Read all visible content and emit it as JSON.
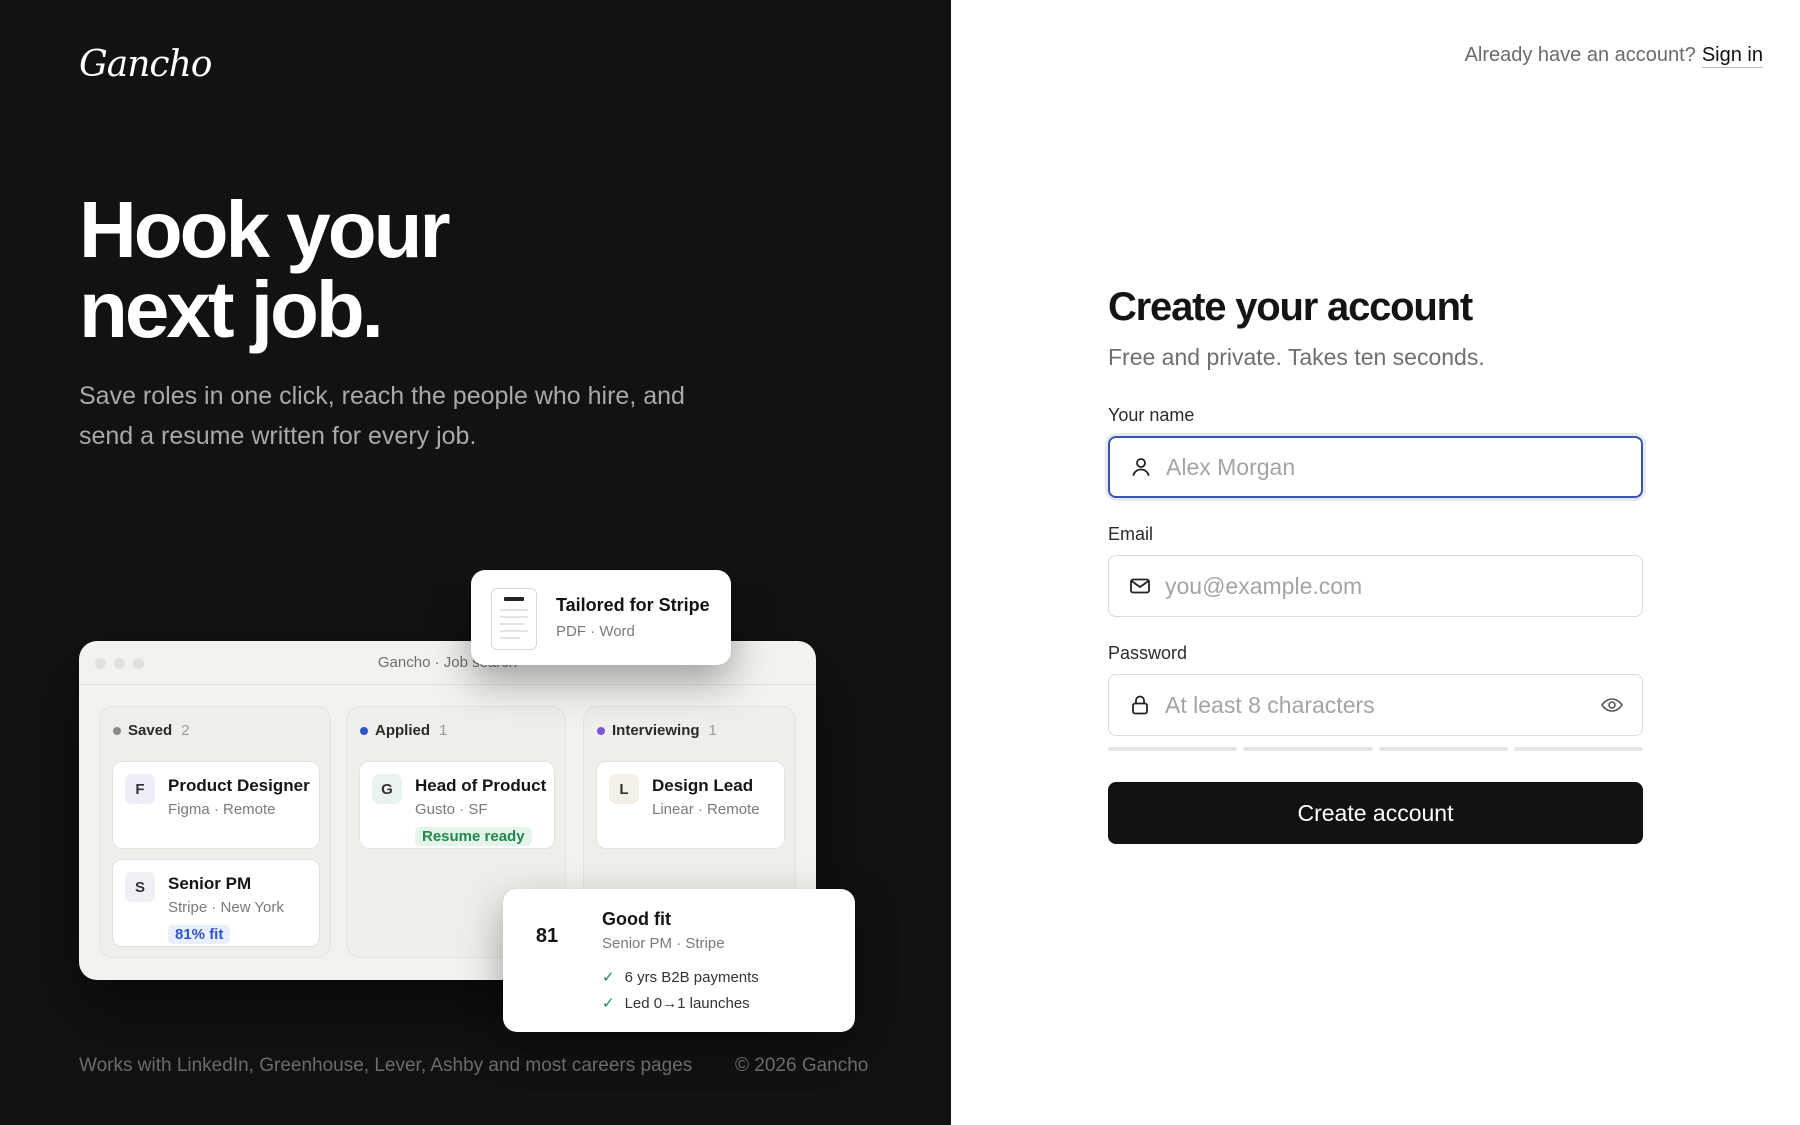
{
  "brand": {
    "logo_text": "Gancho"
  },
  "hero": {
    "headline_line1": "Hook your",
    "headline_line2": "next job.",
    "subtitle": "Save roles in one click, reach the people who hire, and send a resume written for every job."
  },
  "mock": {
    "window_title": "Gancho · Job search",
    "columns": [
      {
        "name": "Saved",
        "count": "2",
        "dot_color": "#8a8a8a"
      },
      {
        "name": "Applied",
        "count": "1",
        "dot_color": "#2f55c9"
      },
      {
        "name": "Interviewing",
        "count": "1",
        "dot_color": "#7b55d6"
      }
    ],
    "jobs": [
      {
        "letter": "F",
        "title": "Product Designer",
        "meta": "Figma · Remote",
        "badge_bg": "#f0ecf8"
      },
      {
        "letter": "S",
        "title": "Senior PM",
        "meta": "Stripe · New York",
        "tag": "81% fit",
        "badge_bg": "#eef0f6"
      },
      {
        "letter": "G",
        "title": "Head of Product",
        "meta": "Gusto · SF",
        "tag": "Resume ready",
        "badge_bg": "#eaf4ee"
      },
      {
        "letter": "L",
        "title": "Design Lead",
        "meta": "Linear · Remote",
        "badge_bg": "#f4f0e8"
      }
    ],
    "tailored_card": {
      "title": "Tailored for Stripe",
      "meta": "PDF · Word"
    },
    "fit_card": {
      "score": "81",
      "title": "Good fit",
      "meta": "Senior PM · Stripe",
      "checks": [
        "6 yrs B2B payments",
        "Led 0→1 launches"
      ]
    }
  },
  "footer": {
    "works_with": "Works with LinkedIn, Greenhouse, Lever, Ashby and most careers pages",
    "copyright": "© 2026 Gancho"
  },
  "auth": {
    "prompt": "Already have an account?",
    "signin_link": "Sign in"
  },
  "form": {
    "title": "Create your account",
    "subtitle": "Free and private. Takes ten seconds.",
    "name_label": "Your name",
    "name_placeholder": "Alex Morgan",
    "email_label": "Email",
    "email_placeholder": "you@example.com",
    "password_label": "Password",
    "password_placeholder": "At least 8 characters",
    "submit_label": "Create account"
  },
  "colors": {
    "left_bg": "#121212",
    "accent_focus": "#3b56a8",
    "fit_tag_bg": "#e8eefc",
    "fit_tag_text": "#2f55c9",
    "resume_tag_bg": "#e4f4ea",
    "resume_tag_text": "#1f8a4c"
  }
}
